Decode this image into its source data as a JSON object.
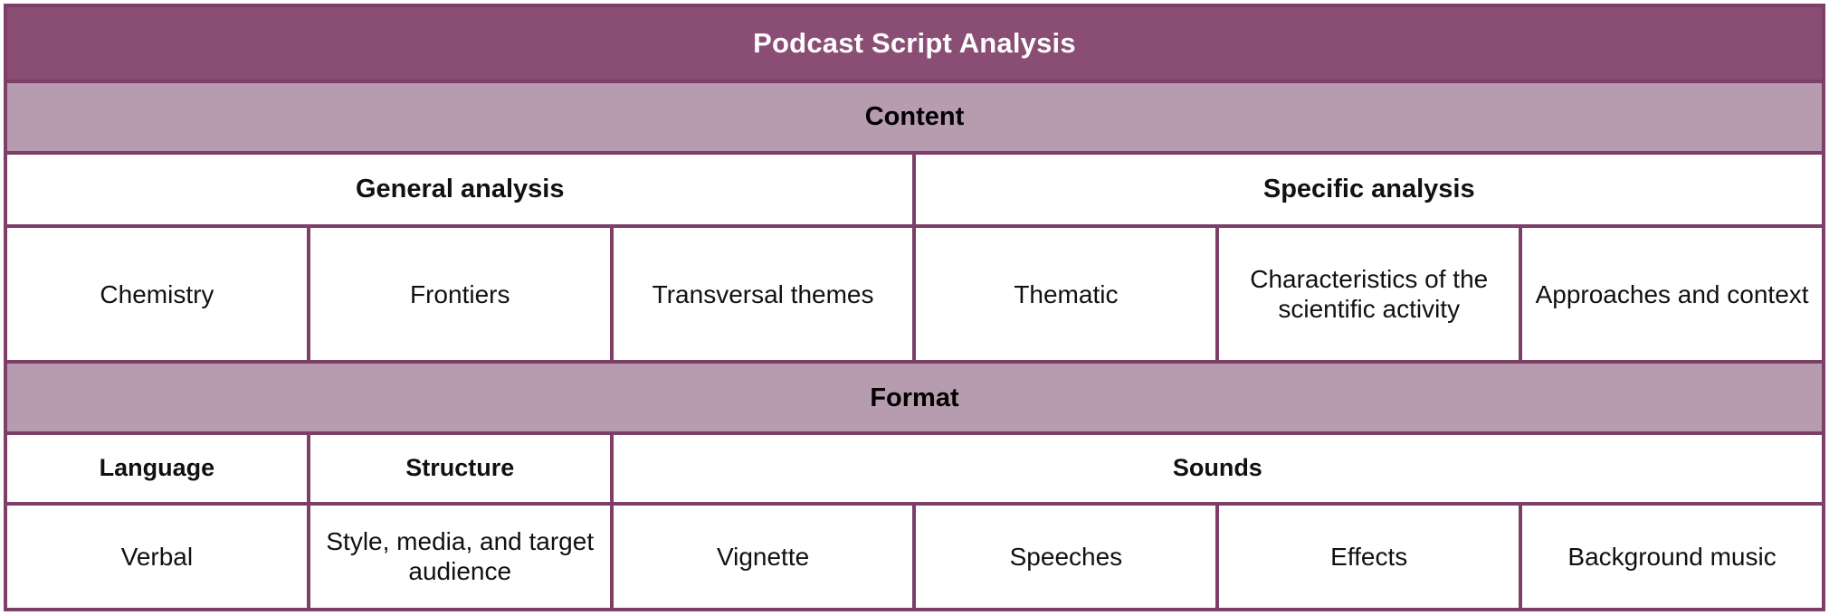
{
  "colors": {
    "title_bg": "#8A4D74",
    "band_bg": "#B79CB0",
    "border": "#7B3F68",
    "title_text": "#FFFFFF",
    "body_text": "#111111",
    "cell_bg": "#FFFFFF"
  },
  "title": "Podcast Script Analysis",
  "sections": [
    {
      "band": "Content",
      "groups": [
        "General analysis",
        "Specific analysis"
      ],
      "leaves": [
        "Chemistry",
        "Frontiers",
        "Transversal themes",
        "Thematic",
        "Characteristics of the scientific activity",
        "Approaches and context"
      ]
    },
    {
      "band": "Format",
      "groups": [
        "Language",
        "Structure",
        "Sounds"
      ],
      "leaves": [
        "Verbal",
        "Style, media, and target audience",
        "Vignette",
        "Speeches",
        "Effects",
        "Background music"
      ]
    }
  ],
  "chart_data": {
    "type": "table",
    "title": "Podcast Script Analysis",
    "columns": 6,
    "rows": [
      {
        "level": "root",
        "cells": [
          {
            "label": "Podcast Script Analysis",
            "span": 6
          }
        ]
      },
      {
        "level": "section",
        "cells": [
          {
            "label": "Content",
            "span": 6
          }
        ]
      },
      {
        "level": "group",
        "cells": [
          {
            "label": "General analysis",
            "span": 3
          },
          {
            "label": "Specific analysis",
            "span": 3
          }
        ]
      },
      {
        "level": "leaf",
        "cells": [
          {
            "label": "Chemistry",
            "span": 1
          },
          {
            "label": "Frontiers",
            "span": 1
          },
          {
            "label": "Transversal themes",
            "span": 1
          },
          {
            "label": "Thematic",
            "span": 1
          },
          {
            "label": "Characteristics of the scientific activity",
            "span": 1
          },
          {
            "label": "Approaches and context",
            "span": 1
          }
        ]
      },
      {
        "level": "section",
        "cells": [
          {
            "label": "Format",
            "span": 6
          }
        ]
      },
      {
        "level": "group",
        "cells": [
          {
            "label": "Language",
            "span": 1
          },
          {
            "label": "Structure",
            "span": 1
          },
          {
            "label": "Sounds",
            "span": 4
          }
        ]
      },
      {
        "level": "leaf",
        "cells": [
          {
            "label": "Verbal",
            "span": 1
          },
          {
            "label": "Style, media, and target audience",
            "span": 1
          },
          {
            "label": "Vignette",
            "span": 1
          },
          {
            "label": "Speeches",
            "span": 1
          },
          {
            "label": "Effects",
            "span": 1
          },
          {
            "label": "Background music",
            "span": 1
          }
        ]
      }
    ]
  }
}
